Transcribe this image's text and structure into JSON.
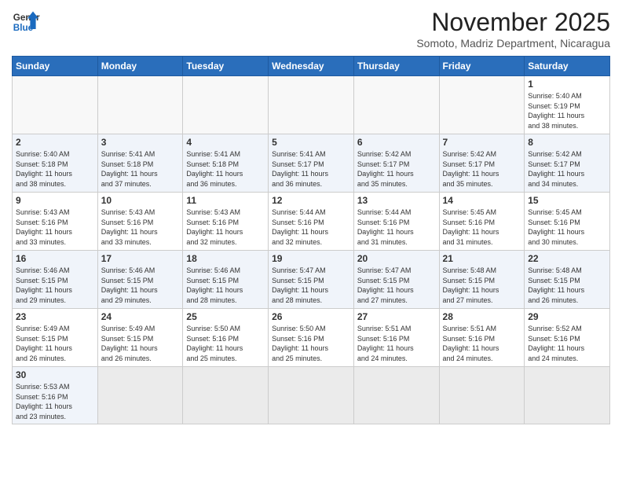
{
  "header": {
    "logo_line1": "General",
    "logo_line2": "Blue",
    "month": "November 2025",
    "location": "Somoto, Madriz Department, Nicaragua"
  },
  "weekdays": [
    "Sunday",
    "Monday",
    "Tuesday",
    "Wednesday",
    "Thursday",
    "Friday",
    "Saturday"
  ],
  "weeks": [
    [
      {
        "day": "",
        "info": ""
      },
      {
        "day": "",
        "info": ""
      },
      {
        "day": "",
        "info": ""
      },
      {
        "day": "",
        "info": ""
      },
      {
        "day": "",
        "info": ""
      },
      {
        "day": "",
        "info": ""
      },
      {
        "day": "1",
        "info": "Sunrise: 5:40 AM\nSunset: 5:19 PM\nDaylight: 11 hours\nand 38 minutes."
      }
    ],
    [
      {
        "day": "2",
        "info": "Sunrise: 5:40 AM\nSunset: 5:18 PM\nDaylight: 11 hours\nand 38 minutes."
      },
      {
        "day": "3",
        "info": "Sunrise: 5:41 AM\nSunset: 5:18 PM\nDaylight: 11 hours\nand 37 minutes."
      },
      {
        "day": "4",
        "info": "Sunrise: 5:41 AM\nSunset: 5:18 PM\nDaylight: 11 hours\nand 36 minutes."
      },
      {
        "day": "5",
        "info": "Sunrise: 5:41 AM\nSunset: 5:17 PM\nDaylight: 11 hours\nand 36 minutes."
      },
      {
        "day": "6",
        "info": "Sunrise: 5:42 AM\nSunset: 5:17 PM\nDaylight: 11 hours\nand 35 minutes."
      },
      {
        "day": "7",
        "info": "Sunrise: 5:42 AM\nSunset: 5:17 PM\nDaylight: 11 hours\nand 35 minutes."
      },
      {
        "day": "8",
        "info": "Sunrise: 5:42 AM\nSunset: 5:17 PM\nDaylight: 11 hours\nand 34 minutes."
      }
    ],
    [
      {
        "day": "9",
        "info": "Sunrise: 5:43 AM\nSunset: 5:16 PM\nDaylight: 11 hours\nand 33 minutes."
      },
      {
        "day": "10",
        "info": "Sunrise: 5:43 AM\nSunset: 5:16 PM\nDaylight: 11 hours\nand 33 minutes."
      },
      {
        "day": "11",
        "info": "Sunrise: 5:43 AM\nSunset: 5:16 PM\nDaylight: 11 hours\nand 32 minutes."
      },
      {
        "day": "12",
        "info": "Sunrise: 5:44 AM\nSunset: 5:16 PM\nDaylight: 11 hours\nand 32 minutes."
      },
      {
        "day": "13",
        "info": "Sunrise: 5:44 AM\nSunset: 5:16 PM\nDaylight: 11 hours\nand 31 minutes."
      },
      {
        "day": "14",
        "info": "Sunrise: 5:45 AM\nSunset: 5:16 PM\nDaylight: 11 hours\nand 31 minutes."
      },
      {
        "day": "15",
        "info": "Sunrise: 5:45 AM\nSunset: 5:16 PM\nDaylight: 11 hours\nand 30 minutes."
      }
    ],
    [
      {
        "day": "16",
        "info": "Sunrise: 5:46 AM\nSunset: 5:15 PM\nDaylight: 11 hours\nand 29 minutes."
      },
      {
        "day": "17",
        "info": "Sunrise: 5:46 AM\nSunset: 5:15 PM\nDaylight: 11 hours\nand 29 minutes."
      },
      {
        "day": "18",
        "info": "Sunrise: 5:46 AM\nSunset: 5:15 PM\nDaylight: 11 hours\nand 28 minutes."
      },
      {
        "day": "19",
        "info": "Sunrise: 5:47 AM\nSunset: 5:15 PM\nDaylight: 11 hours\nand 28 minutes."
      },
      {
        "day": "20",
        "info": "Sunrise: 5:47 AM\nSunset: 5:15 PM\nDaylight: 11 hours\nand 27 minutes."
      },
      {
        "day": "21",
        "info": "Sunrise: 5:48 AM\nSunset: 5:15 PM\nDaylight: 11 hours\nand 27 minutes."
      },
      {
        "day": "22",
        "info": "Sunrise: 5:48 AM\nSunset: 5:15 PM\nDaylight: 11 hours\nand 26 minutes."
      }
    ],
    [
      {
        "day": "23",
        "info": "Sunrise: 5:49 AM\nSunset: 5:15 PM\nDaylight: 11 hours\nand 26 minutes."
      },
      {
        "day": "24",
        "info": "Sunrise: 5:49 AM\nSunset: 5:15 PM\nDaylight: 11 hours\nand 26 minutes."
      },
      {
        "day": "25",
        "info": "Sunrise: 5:50 AM\nSunset: 5:16 PM\nDaylight: 11 hours\nand 25 minutes."
      },
      {
        "day": "26",
        "info": "Sunrise: 5:50 AM\nSunset: 5:16 PM\nDaylight: 11 hours\nand 25 minutes."
      },
      {
        "day": "27",
        "info": "Sunrise: 5:51 AM\nSunset: 5:16 PM\nDaylight: 11 hours\nand 24 minutes."
      },
      {
        "day": "28",
        "info": "Sunrise: 5:51 AM\nSunset: 5:16 PM\nDaylight: 11 hours\nand 24 minutes."
      },
      {
        "day": "29",
        "info": "Sunrise: 5:52 AM\nSunset: 5:16 PM\nDaylight: 11 hours\nand 24 minutes."
      }
    ],
    [
      {
        "day": "30",
        "info": "Sunrise: 5:53 AM\nSunset: 5:16 PM\nDaylight: 11 hours\nand 23 minutes."
      },
      {
        "day": "",
        "info": ""
      },
      {
        "day": "",
        "info": ""
      },
      {
        "day": "",
        "info": ""
      },
      {
        "day": "",
        "info": ""
      },
      {
        "day": "",
        "info": ""
      },
      {
        "day": "",
        "info": ""
      }
    ]
  ]
}
